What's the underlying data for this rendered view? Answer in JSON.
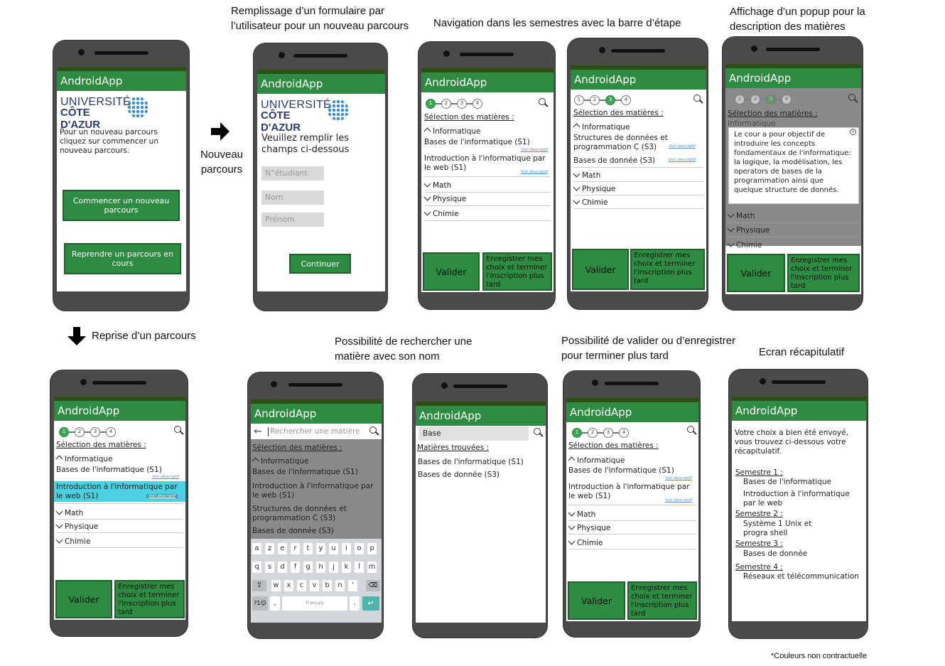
{
  "captions": {
    "c1": "Remplissage d’un formulaire par l’utilisateur pour un nouveau parcours",
    "c2": "Navigation dans les semestres avec la barre d’étape",
    "c3": "Affichage d’un popup pour la description des matières",
    "nouveau": "Nouveau parcours",
    "reprise": "Reprise d’un parcours",
    "c4": "Possibilité de rechercher une matière avec son nom",
    "c5": "Possibilité de valider ou d’enregistrer pour terminer plus tard",
    "c6": "Ecran récapitulatif",
    "footnote": "*Couleurs non contractuelle"
  },
  "app_title": "AndroidApp",
  "logo": {
    "line1": "UNIVERSITÉ",
    "line2": "CÔTE D'AZUR"
  },
  "home": {
    "text": "Pour un nouveau parcours cliquez sur commencer un nouveau parcours.",
    "start_button": "Commencer un nouveau parcours",
    "resume_button": "Reprendre un parcours en cours"
  },
  "form": {
    "heading": "Veuillez remplir les champs ci-dessous",
    "student_placeholder": "N°étudiant",
    "nom_placeholder": "Nom",
    "prenom_placeholder": "Prénom",
    "continue_button": "Continuer"
  },
  "selection": {
    "heading": "Sélection des matières :",
    "informatique": "Informatique",
    "math": "Math",
    "physique": "Physique",
    "chimie": "Chimie",
    "course_bases": "Bases de l'informatique (S1)",
    "course_intro": "Introduction à l'informatique par le web (S1)",
    "course_struct": "Structures de données et programmation C (S3)",
    "course_bd": "Bases de donnée (S3)",
    "voir": "Voir descriptif",
    "valider": "Valider",
    "save": "Enregistrer mes choix et terminer l'inscription plus tard",
    "steps": [
      "1",
      "2",
      "3",
      "4"
    ]
  },
  "popup": {
    "text": "Le cour a pour objectif de introduire les concepts fondamentaux de l'informatique: la logique, la modélisation, les operators de bases de la programmation ainsi que quelque structure de donnés.",
    "partial": "Informatique"
  },
  "search": {
    "placeholder": "Rechercher une matière",
    "query": "Base",
    "found_heading": "Matières trouvées :",
    "keyboard_row1": [
      "a",
      "z",
      "e",
      "r",
      "t",
      "y",
      "u",
      "i",
      "o",
      "p"
    ],
    "keyboard_row2": [
      "q",
      "s",
      "d",
      "f",
      "g",
      "h",
      "j",
      "k",
      "l",
      "m"
    ],
    "keyboard_row3": [
      "w",
      "x",
      "c",
      "v",
      "b",
      "n",
      "'"
    ],
    "sym_key": "?1☺",
    "comma_key": ",",
    "space_label": "Français",
    "period_key": "."
  },
  "recap": {
    "intro": "Votre choix a bien été envoyé, vous trouvez ci-dessous votre récapitulatif.",
    "s1_label": "Semestre 1 :",
    "s1_a": "Bases de l'informatique",
    "s1_b": "Introduction à l'informatique par le web",
    "s2_label": "Semestre 2 :",
    "s2_a": "Système 1 Unix et progra shell",
    "s3_label": "Semestre 3 :",
    "s3_a": "Bases de donnée",
    "s4_label": "Semestre 4 :",
    "s4_a": "Réseaux et télécommunication"
  }
}
